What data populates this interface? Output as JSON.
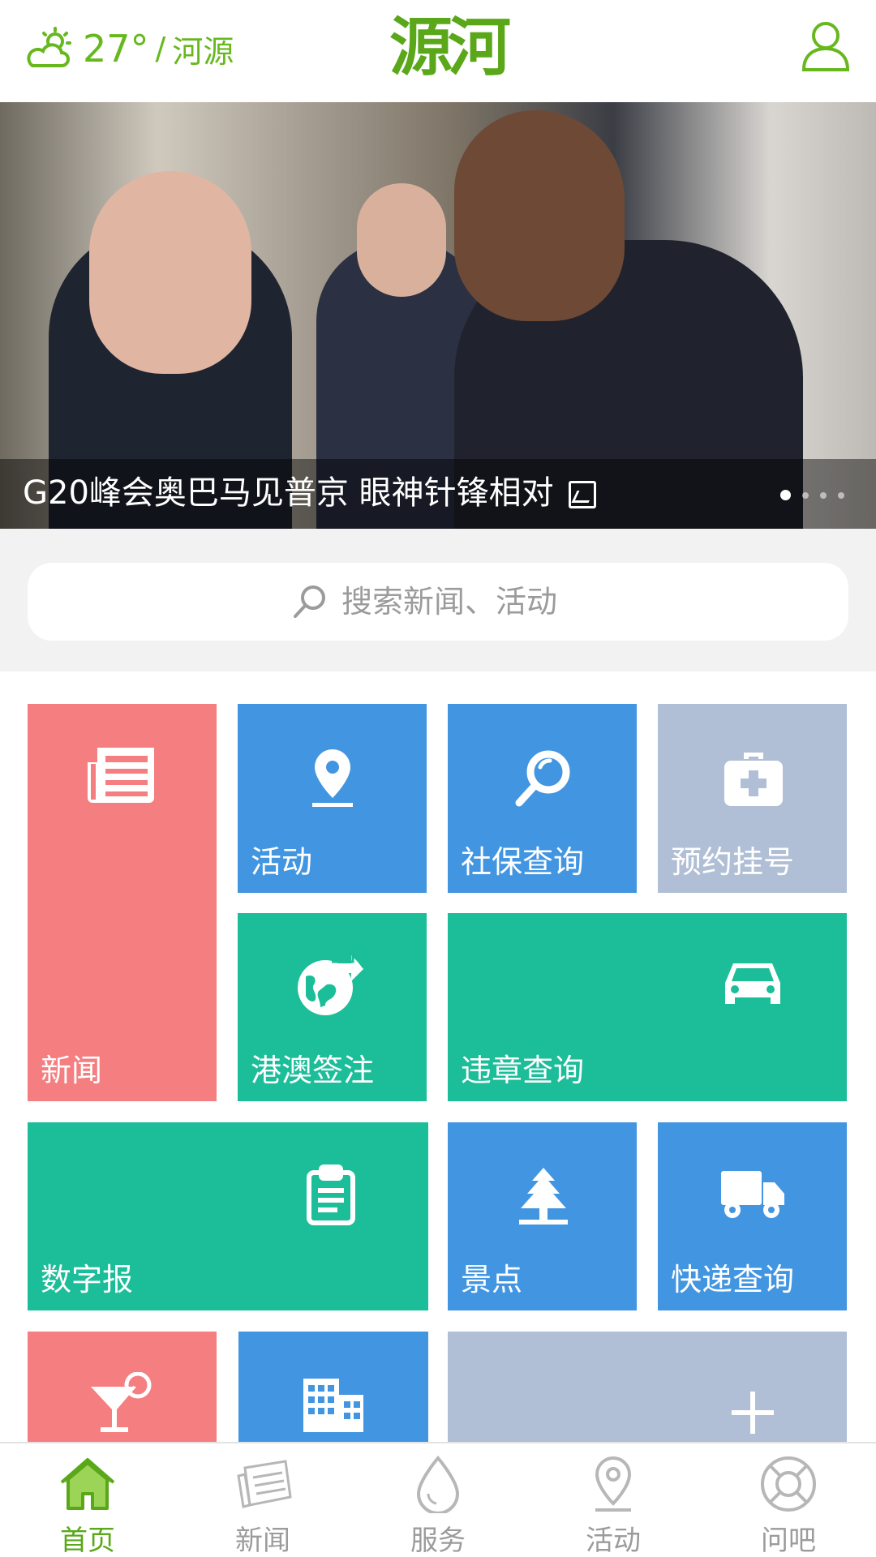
{
  "header": {
    "weather_icon": "partly-cloudy-icon",
    "temperature": "27°",
    "separator": "/",
    "city": "河源",
    "logo_text": "源河",
    "brand_color": "#67b81f",
    "user_icon": "user-icon"
  },
  "banner": {
    "caption": "G20峰会奥巴马见普京 眼神针锋相对",
    "caption_icon": "gallery-icon",
    "slides_total": 4,
    "slide_current": 1
  },
  "search": {
    "placeholder": "搜索新闻、活动",
    "icon": "search-icon"
  },
  "tiles": {
    "news": {
      "label": "新闻",
      "icon": "newspaper-icon",
      "color": "#f47e80"
    },
    "activity": {
      "label": "活动",
      "icon": "location-pin-icon",
      "color": "#4295e0"
    },
    "social_security": {
      "label": "社保查询",
      "icon": "magnifier-icon",
      "color": "#4295e0"
    },
    "appointment": {
      "label": "预约挂号",
      "icon": "medical-kit-icon",
      "color": "#b0bfd5"
    },
    "hk_macao": {
      "label": "港澳签注",
      "icon": "globe-arrow-icon",
      "color": "#1cbd99"
    },
    "traffic": {
      "label": "违章查询",
      "icon": "car-icon",
      "color": "#1cbd99"
    },
    "digital_paper": {
      "label": "数字报",
      "icon": "clipboard-icon",
      "color": "#1cbd99"
    },
    "scenic": {
      "label": "景点",
      "icon": "tree-icon",
      "color": "#4295e0"
    },
    "express": {
      "label": "快递查询",
      "icon": "truck-icon",
      "color": "#4295e0"
    },
    "leisure": {
      "label": "",
      "icon": "cocktail-icon",
      "color": "#f47e80"
    },
    "building": {
      "label": "",
      "icon": "building-icon",
      "color": "#4295e0"
    },
    "add": {
      "label": "",
      "icon": "plus-icon",
      "color": "#b0bfd5"
    }
  },
  "bottom_nav": {
    "items": [
      {
        "label": "首页",
        "icon": "home-icon",
        "active": true
      },
      {
        "label": "新闻",
        "icon": "news-paper-icon",
        "active": false
      },
      {
        "label": "服务",
        "icon": "water-drop-icon",
        "active": false
      },
      {
        "label": "活动",
        "icon": "location-pin-icon",
        "active": false
      },
      {
        "label": "问吧",
        "icon": "lifebuoy-icon",
        "active": false
      }
    ],
    "active_color": "#5aa81a",
    "inactive_color": "#9b9b9b"
  }
}
